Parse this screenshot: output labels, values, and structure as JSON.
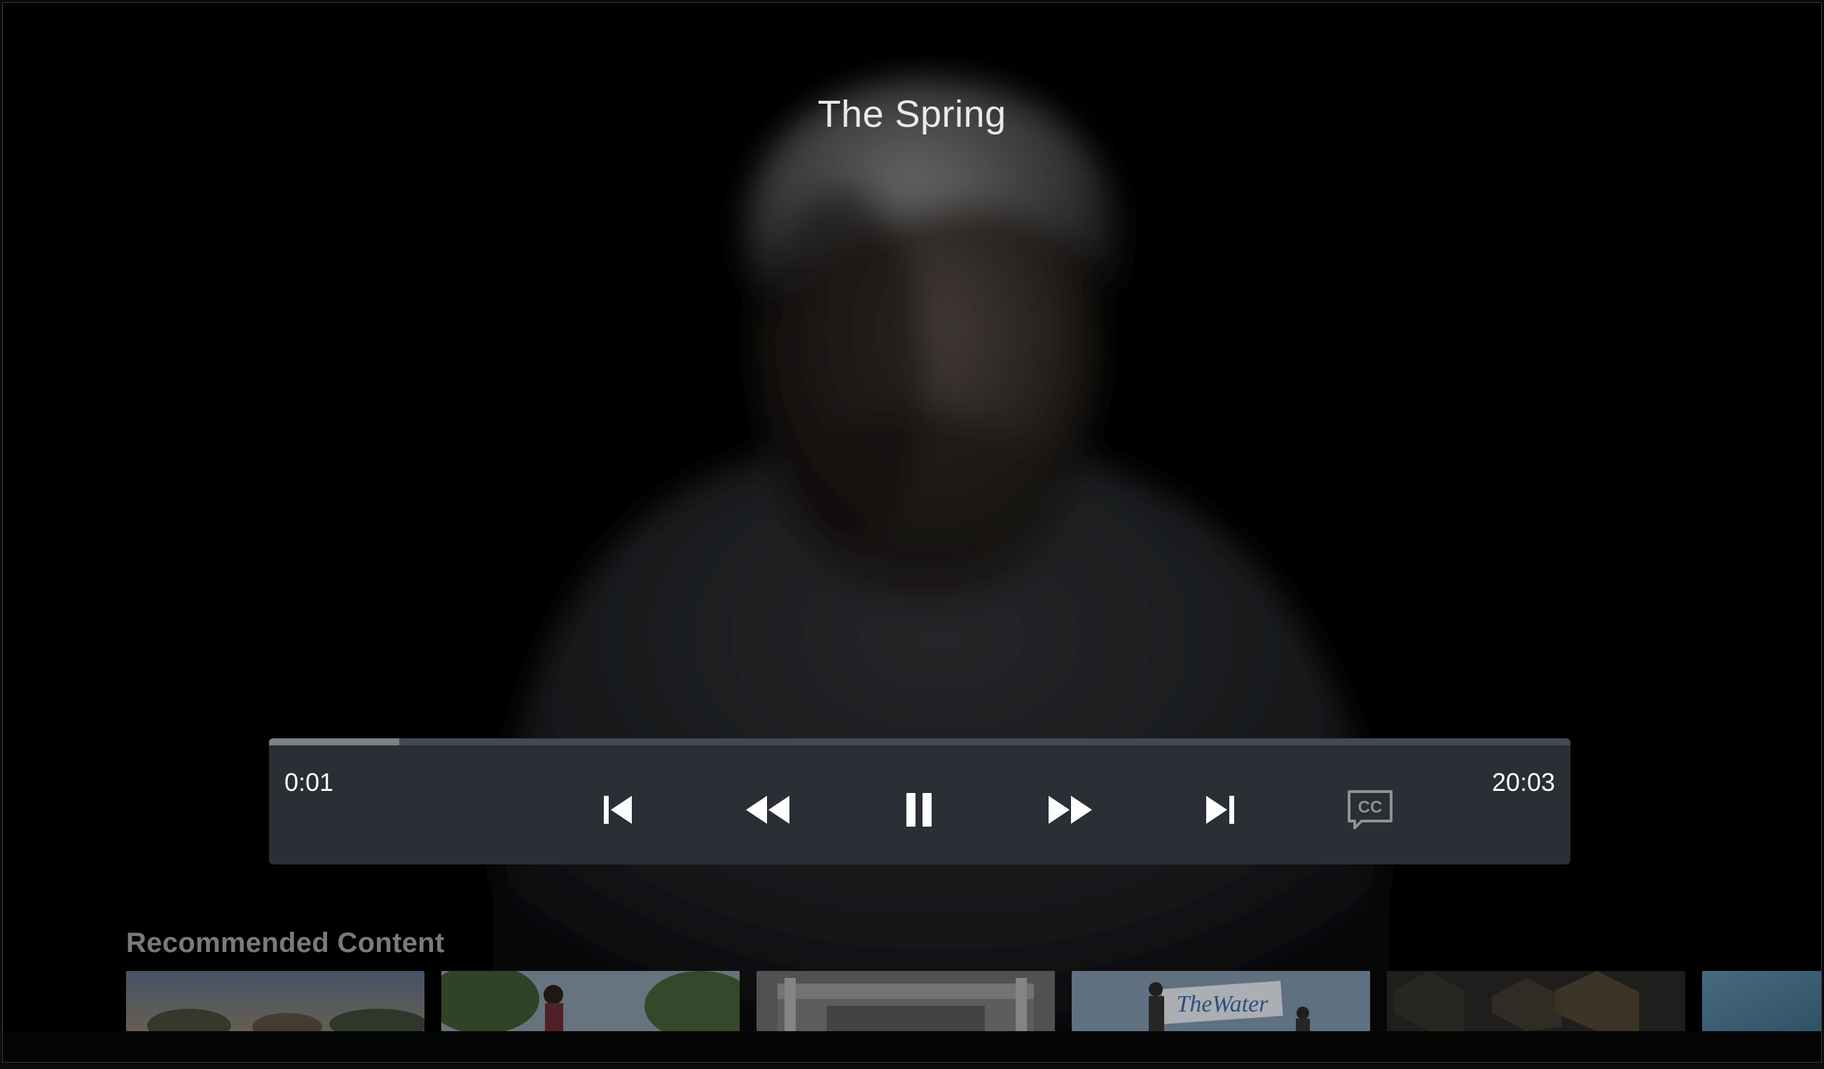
{
  "video": {
    "title": "The Spring"
  },
  "player": {
    "elapsed": "0:01",
    "duration": "20:03",
    "progress_fraction": 0.1,
    "buttons": {
      "skip_previous": "skip-previous-icon",
      "rewind": "rewind-icon",
      "pause": "pause-icon",
      "fast_forward": "fast-forward-icon",
      "skip_next": "skip-next-icon",
      "captions": "closed-captions-icon"
    },
    "colors": {
      "bar": "#2a2e35",
      "progress": "#7d8187",
      "icon": "#ffffff",
      "icon_disabled": "#8e9297"
    }
  },
  "recommended": {
    "heading": "Recommended Content",
    "items": [
      {
        "label": ""
      },
      {
        "label": ""
      },
      {
        "label": ""
      },
      {
        "label": "TheWater"
      },
      {
        "label": ""
      },
      {
        "label": ""
      }
    ]
  }
}
